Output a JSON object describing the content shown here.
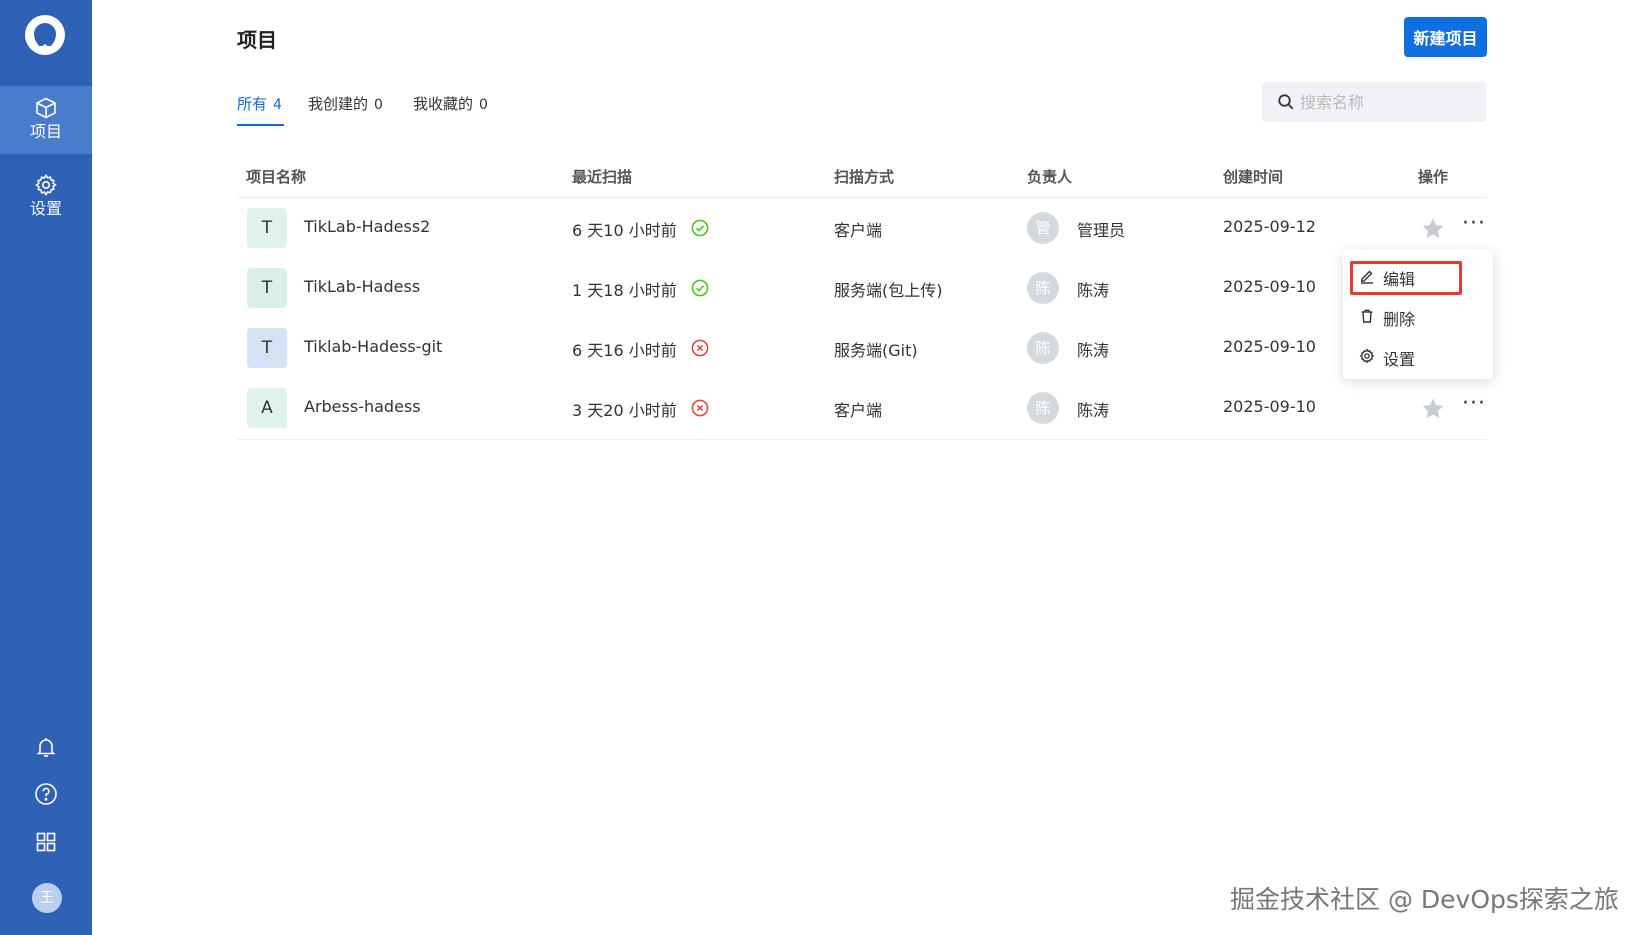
{
  "sidebar": {
    "items": [
      {
        "label": "项目",
        "icon": "cube-icon",
        "active": true
      },
      {
        "label": "设置",
        "icon": "gear-icon",
        "active": false
      }
    ],
    "bottom_icons": [
      "bell-icon",
      "help-circle-icon",
      "apps-grid-icon"
    ],
    "user_initial": "王"
  },
  "header": {
    "title": "项目",
    "new_button": "新建项目"
  },
  "tabs": [
    {
      "label": "所有",
      "count": "4",
      "active": true
    },
    {
      "label": "我创建的",
      "count": "0",
      "active": false
    },
    {
      "label": "我收藏的",
      "count": "0",
      "active": false
    }
  ],
  "search": {
    "placeholder": "搜索名称",
    "value": ""
  },
  "table": {
    "columns": [
      "项目名称",
      "最近扫描",
      "扫描方式",
      "负责人",
      "创建时间",
      "操作"
    ],
    "rows": [
      {
        "initial": "T",
        "icon_color": "#dff2ec",
        "name": "TikLab-Hadess2",
        "last_scan": "6 天10 小时前",
        "scan_status": "success",
        "scan_method": "客户端",
        "owner_initial": "管",
        "owner": "管理员",
        "created": "2025-09-12"
      },
      {
        "initial": "T",
        "icon_color": "#d9efe8",
        "name": "TikLab-Hadess",
        "last_scan": "1 天18 小时前",
        "scan_status": "success",
        "scan_method": "服务端(包上传)",
        "owner_initial": "陈",
        "owner": "陈涛",
        "created": "2025-09-10"
      },
      {
        "initial": "T",
        "icon_color": "#d5e2f6",
        "name": "Tiklab-Hadess-git",
        "last_scan": "6 天16 小时前",
        "scan_status": "failed",
        "scan_method": "服务端(Git)",
        "owner_initial": "陈",
        "owner": "陈涛",
        "created": "2025-09-10"
      },
      {
        "initial": "A",
        "icon_color": "#dff2ec",
        "name": "Arbess-hadess",
        "last_scan": "3 天20 小时前",
        "scan_status": "failed",
        "scan_method": "客户端",
        "owner_initial": "陈",
        "owner": "陈涛",
        "created": "2025-09-10"
      }
    ]
  },
  "action_menu": {
    "items": [
      {
        "label": "编辑",
        "icon": "edit-icon"
      },
      {
        "label": "删除",
        "icon": "trash-icon"
      },
      {
        "label": "设置",
        "icon": "gear-icon"
      }
    ]
  },
  "colors": {
    "sidebar": "#2f62b6",
    "accent": "#0f6ee0",
    "success": "#52c41a",
    "failed": "#e5484d",
    "highlight": "#e53935"
  },
  "watermark": "掘金技术社区 @ DevOps探索之旅"
}
